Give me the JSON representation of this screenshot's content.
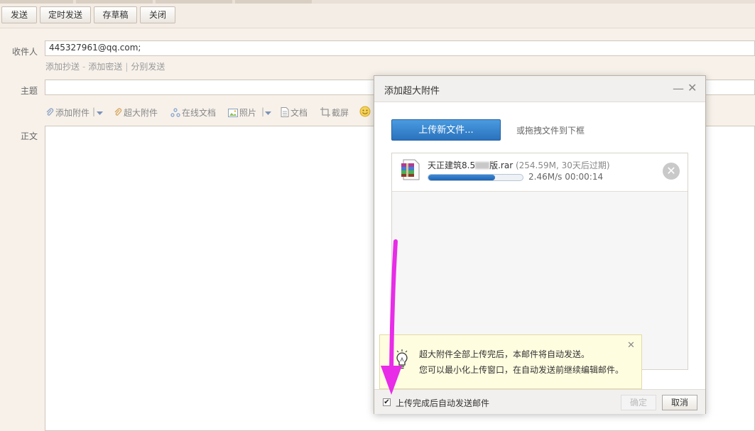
{
  "toolbar": {
    "send": "发送",
    "scheduled_send": "定时发送",
    "save_draft": "存草稿",
    "close": "关闭"
  },
  "compose": {
    "to_label": "收件人",
    "to_value": "445327961@qq.com;",
    "add_cc": "添加抄送",
    "add_bcc": "添加密送",
    "separate_send": "分别发送",
    "subject_label": "主题",
    "body_label": "正文",
    "attach_tools": {
      "add_attachment": "添加附件",
      "large_attachment": "超大附件",
      "online_doc": "在线文档",
      "photo": "照片",
      "document": "文档",
      "screenshot": "截屏"
    }
  },
  "dialog": {
    "title": "添加超大附件",
    "upload_button": "上传新文件...",
    "drag_hint": "或拖拽文件到下框",
    "file": {
      "name": "天正建筑8.5",
      "name_suffix": "版.rar",
      "meta": "(254.59M, 30天后过期)",
      "speed": "2.46M/s",
      "time_left": "00:00:14",
      "progress_percent": 71
    },
    "tip_line1": "超大附件全部上传完后，本邮件将自动发送。",
    "tip_line2": "您可以最小化上传窗口，在自动发送前继续编辑邮件。",
    "auto_send_checkbox": "上传完成后自动发送邮件",
    "auto_send_checked": true,
    "confirm": "确定",
    "cancel": "取消"
  },
  "colors": {
    "accent_blue": "#2a72bd",
    "annotation_arrow": "#e82ce8",
    "tip_background": "#fffde0"
  }
}
